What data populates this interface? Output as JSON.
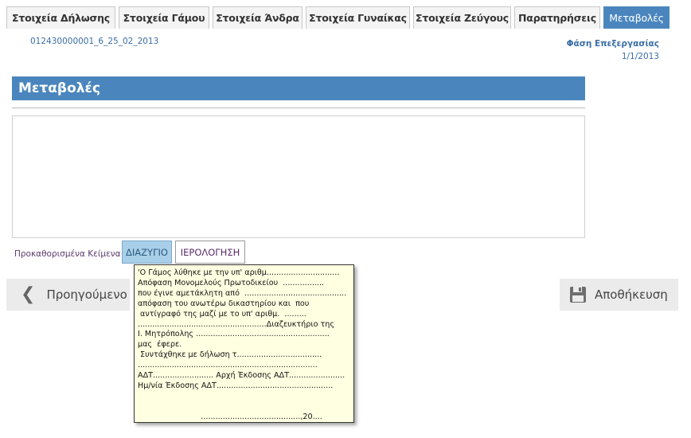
{
  "tabs": [
    {
      "label": "Στοιχεία Δήλωσης",
      "active": false
    },
    {
      "label": "Στοιχεία Γάμου",
      "active": false
    },
    {
      "label": "Στοιχεία Άνδρα",
      "active": false
    },
    {
      "label": "Στοιχεία Γυναίκας",
      "active": false
    },
    {
      "label": "Στοιχεία Ζεύγους",
      "active": false
    },
    {
      "label": "Παρατηρήσεις",
      "active": false
    },
    {
      "label": "Μεταβολές",
      "active": true
    }
  ],
  "record": {
    "id": "012430000001_6_25_02_2013",
    "phase_label": "Φάση Επεξεργασίας",
    "phase_date": "1/1/2013"
  },
  "section": {
    "title": "Μεταβολές",
    "text_value": ""
  },
  "presets": {
    "label": "Προκαθορισμένα Κείμενα",
    "divorce": "ΔΙΑΖΥΓΙΟ",
    "wedding": "ΙΕΡΟΛΟΓΗΣΗ"
  },
  "nav": {
    "previous": "Προηγούμενο",
    "save": "Αποθήκευση"
  },
  "tooltip": {
    "lines": [
      "'Ο Γάμος λύθηκε με την υπ' αριθμ..............................",
      "Απόφαση Μονομελούς Πρωτοδικείου  .................",
      "που έγινε αμετάκλητη από  ..........................................",
      "απόφαση του ανωτέρω δικαστηρίου και  που",
      " αντίγραφό της μαζί με το υπ' αριθμ.  .........",
      ".....................................................Διαζευκτήριο της",
      "Ι. Μητρόπολης .......................................................",
      "μας  έφερε.",
      " Συντάχθηκε με δήλωση τ...................................",
      "..........................................................................",
      "ΑΔΤ......................... Αρχή Έκδοσης ΑΔΤ.......................",
      "Ημ/νία Έκδοσης ΑΔΤ................................................",
      "",
      "",
      "                          .........................................,20...."
    ]
  },
  "colors": {
    "accent": "#4a86bd",
    "link": "#3a6ea5",
    "tooltip_bg": "#ffffe1"
  }
}
